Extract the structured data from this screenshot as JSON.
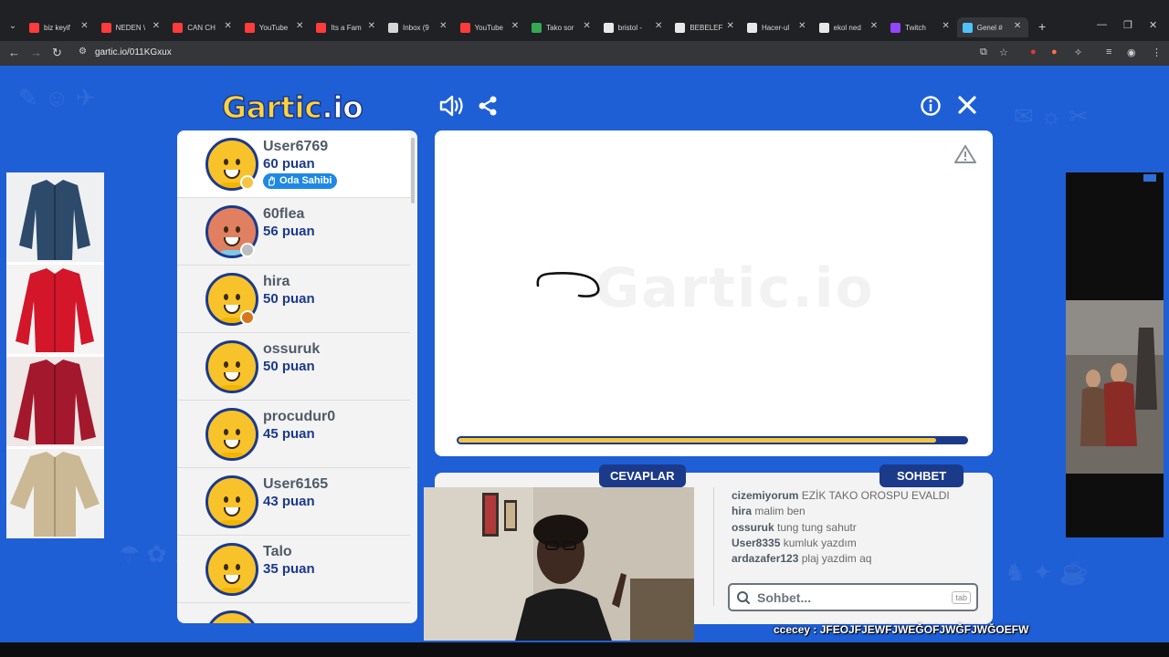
{
  "browser": {
    "tabs": [
      {
        "title": "biz keyif",
        "color": "#ff3b3b",
        "active": false
      },
      {
        "title": "NEDEN \\",
        "color": "#ff3b3b",
        "active": false
      },
      {
        "title": "CAN CH",
        "color": "#ff3b3b",
        "active": false
      },
      {
        "title": "YouTube",
        "color": "#ff3b3b",
        "active": false
      },
      {
        "title": "Its a Fam",
        "color": "#ff3b3b",
        "active": false
      },
      {
        "title": "Inbox (9",
        "color": "#d6d6d6",
        "active": false
      },
      {
        "title": "YouTube",
        "color": "#ff3b3b",
        "active": false
      },
      {
        "title": "Tako sor",
        "color": "#34a853",
        "active": false
      },
      {
        "title": "bristol -",
        "color": "#e8e8e8",
        "active": false
      },
      {
        "title": "BEBELEF",
        "color": "#e8e8e8",
        "active": false
      },
      {
        "title": "Hacer-ul",
        "color": "#e8e8e8",
        "active": false
      },
      {
        "title": "ekol ned",
        "color": "#e8e8e8",
        "active": false
      },
      {
        "title": "Twitch",
        "color": "#9146ff",
        "active": false
      },
      {
        "title": "Genel #",
        "color": "#4fc3f7",
        "active": true
      }
    ],
    "url": "gartic.io/011KGxux"
  },
  "game": {
    "logo_main": "Gartic",
    "logo_suffix": ".io",
    "owner_badge": "Oda Sahibi",
    "players": [
      {
        "name": "User6769",
        "score": "60 puan",
        "status_color": "#f5c542",
        "owner": true,
        "avatar": "yellow"
      },
      {
        "name": "60flea",
        "score": "56 puan",
        "status_color": "#bdbdbd",
        "owner": false,
        "avatar": "red"
      },
      {
        "name": "hira",
        "score": "50 puan",
        "status_color": "#d7761f",
        "owner": false,
        "avatar": "yellow"
      },
      {
        "name": "ossuruk",
        "score": "50 puan",
        "status_color": "",
        "owner": false,
        "avatar": "yellow"
      },
      {
        "name": "procudur0",
        "score": "45 puan",
        "status_color": "",
        "owner": false,
        "avatar": "yellow"
      },
      {
        "name": "User6165",
        "score": "43 puan",
        "status_color": "",
        "owner": false,
        "avatar": "yellow"
      },
      {
        "name": "Talo",
        "score": "35 puan",
        "status_color": "",
        "owner": false,
        "avatar": "yellow"
      }
    ],
    "timer_fraction": 0.94,
    "answers_label": "CEVAPLAR",
    "chat_label": "SOHBET",
    "chat_messages": [
      {
        "user": "cizemiyorum",
        "text": "EZİK TAKO OROSPU EVALDI"
      },
      {
        "user": "hira",
        "text": "malim ben"
      },
      {
        "user": "ossuruk",
        "text": "tung tung sahutr"
      },
      {
        "user": "User8335",
        "text": "kumluk yazdım"
      },
      {
        "user": "ardazafer123",
        "text": "plaj yazdim aq"
      }
    ],
    "chat_placeholder": "Sohbet...",
    "chat_tab_hint": "tab"
  },
  "overlay": {
    "caption_user": "ccecey",
    "caption_text": "JFEOJFJEWFJWEĞOFJWĞFJWĞOEFW"
  },
  "colors": {
    "page_bg": "#1f5fd6",
    "panel": "#f3f3f3",
    "navy": "#1c3a8a",
    "gold": "#f5c542"
  }
}
